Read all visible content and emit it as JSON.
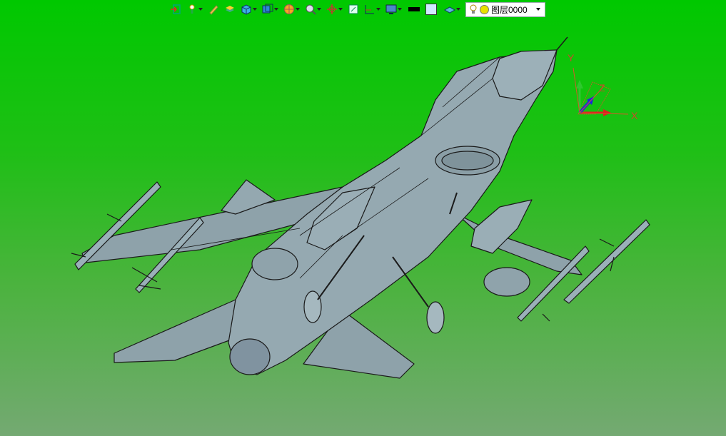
{
  "toolbar": {
    "items": [
      {
        "icon": "import-icon",
        "has_dropdown": false
      },
      {
        "icon": "light-icon",
        "has_dropdown": true
      },
      {
        "icon": "pencil-icon",
        "has_dropdown": false
      },
      {
        "icon": "layer-stack-icon",
        "has_dropdown": false
      },
      {
        "icon": "cube-icon",
        "has_dropdown": true
      },
      {
        "icon": "view-cube-icon",
        "has_dropdown": true
      },
      {
        "icon": "render-ball-icon",
        "has_dropdown": true
      },
      {
        "icon": "zoom-icon",
        "has_dropdown": true
      },
      {
        "icon": "rotate-icon",
        "has_dropdown": true
      },
      {
        "icon": "fit-view-icon",
        "has_dropdown": false
      },
      {
        "icon": "section-icon",
        "has_dropdown": true
      },
      {
        "icon": "display-icon",
        "has_dropdown": true
      }
    ],
    "line_color": "#000000",
    "fill_color": "#cfe8ff",
    "layer_icon": "layer-plane-icon",
    "layer_name": "图层0000"
  },
  "axes": {
    "x": "X",
    "y": "Y",
    "z": "Z"
  },
  "colors": {
    "background_top": "#00c800",
    "background_bottom": "#74a972",
    "model": "#8fa4ac"
  }
}
